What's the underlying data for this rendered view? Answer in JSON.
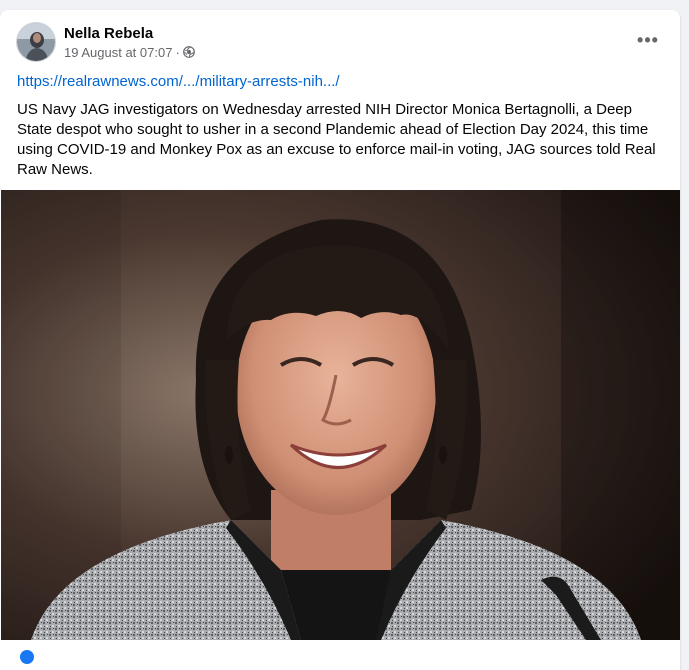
{
  "post": {
    "author": "Nella Rebela",
    "timestamp": "19 August at 07:07",
    "separator": "·",
    "audience_icon": "globe-icon",
    "more_options_label": "•••",
    "link_text": "https://realrawnews.com/.../military-arrests-nih.../",
    "body": "US Navy JAG investigators on Wednesday arrested NIH Director Monica Bertagnolli, a Deep State despot who sought to usher in a second Plandemic ahead of Election Day 2024, this time using COVID-19 and Monkey Pox as an excuse to enforce mail-in voting, JAG sources told Real Raw News.",
    "image_icon": "photo-woman-portrait"
  },
  "colors": {
    "link": "#0064d1",
    "text": "#050505",
    "muted": "#65676b",
    "background": "#f0f2f5",
    "card": "#ffffff"
  }
}
